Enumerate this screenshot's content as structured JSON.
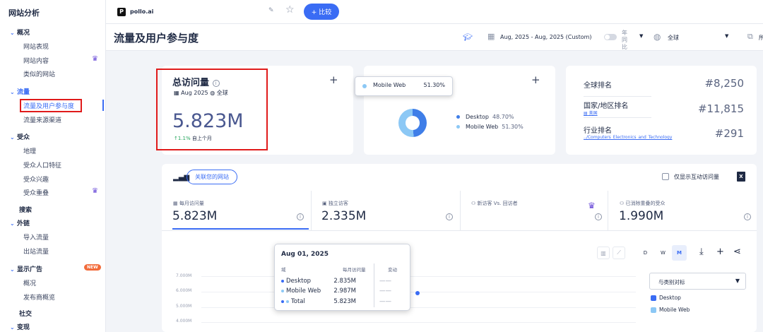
{
  "sidebar": {
    "title": "网站分析",
    "sections": {
      "overview": "概况",
      "traffic": "流量",
      "audience": "受众",
      "search": "搜索",
      "backlinks": "外链",
      "display_ads": "显示广告",
      "social": "社交",
      "monetization": "变现"
    },
    "items": {
      "site_performance": "网站表现",
      "site_content": "网站内容",
      "similar_sites": "类似的网站",
      "traffic_engagement": "流量及用户参与度",
      "traffic_sources": "流量来源渠道",
      "geography": "地理",
      "demographics": "受众人口特征",
      "interests": "受众兴趣",
      "audience_overlap": "受众重叠",
      "incoming_traffic": "导入流量",
      "outgoing_traffic": "出站流量",
      "ads_overview": "概况",
      "publisher_overview": "发布商概览"
    },
    "new_badge": "NEW"
  },
  "topbar": {
    "site_logo": "P",
    "site_name": "pollo.ai",
    "compare_label": "+ 比较"
  },
  "subbar": {
    "page_title": "流量及用户参与度",
    "date_range": "Aug, 2025 - Aug, 2025 (Custom)",
    "yoy_label": "年同比",
    "region": "全球",
    "compare_cut": "所有"
  },
  "total_visits": {
    "title": "总访问量",
    "month": "Aug 2025",
    "region": "全球",
    "value": "5.823M",
    "change": "↑1.1%",
    "change_label": "自上个月"
  },
  "device_card": {
    "tooltip": {
      "label": "Mobile Web",
      "value": "51.30%"
    },
    "legend": [
      {
        "label": "Desktop",
        "value": "48.70%",
        "color": "#3f7ee8",
        "share": 48.7
      },
      {
        "label": "Mobile Web",
        "value": "51.30%",
        "color": "#8cc8f5",
        "share": 51.3
      }
    ]
  },
  "ranks": {
    "global_label": "全球排名",
    "global_value": "#8,250",
    "country_label": "国家/地区排名",
    "country_sub": "美国",
    "country_value": "#11,815",
    "industry_label": "行业排名",
    "industry_sub": "../Computers_Electronics_and_Technology",
    "industry_value": "#291"
  },
  "main": {
    "partner_button": "关联您的网站",
    "engaged_only": "仅显示互动访问量",
    "excel": "X",
    "metrics": [
      {
        "label": "每月访问量",
        "value": "5.823M"
      },
      {
        "label": "独立访客",
        "value": "2.335M"
      },
      {
        "label": "新访客 Vs. 回访者",
        "value": ""
      },
      {
        "label": "已消除重叠的受众",
        "value": "1.990M"
      }
    ],
    "y_ticks": [
      "7.000M",
      "6.000M",
      "5.000M",
      "4.000M"
    ],
    "tooltip": {
      "date": "Aug 01, 2025",
      "col_domain": "域",
      "col_visits": "每月访问量",
      "col_change": "变动",
      "rows": [
        {
          "name": "Desktop",
          "value": "2.835M",
          "change": "——"
        },
        {
          "name": "Mobile Web",
          "value": "2.987M",
          "change": "——"
        },
        {
          "name": "Total",
          "value": "5.823M",
          "change": "——"
        }
      ]
    },
    "granularity": [
      "D",
      "W",
      "M"
    ],
    "granularity_selected": "M",
    "compare_select": "与类别对标",
    "legend": [
      {
        "label": "Desktop",
        "color": "#3a6cf4"
      },
      {
        "label": "Mobile Web",
        "color": "#8cc8f5"
      }
    ]
  }
}
